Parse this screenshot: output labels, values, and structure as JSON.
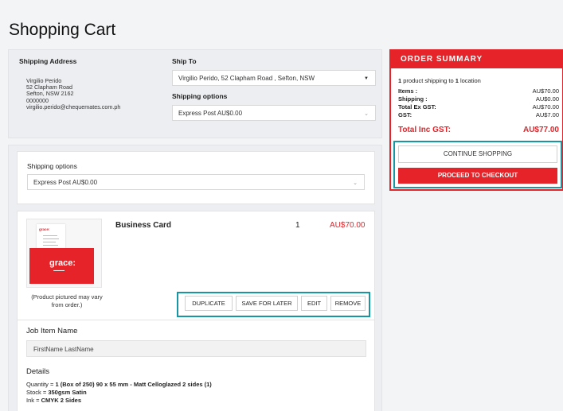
{
  "page": {
    "title": "Shopping Cart"
  },
  "shipping_address": {
    "title": "Shipping Address",
    "lines": [
      "Virgilio Perido",
      "52 Clapham Road",
      "Sefton, NSW 2162",
      "0000000",
      "virgilio.perido@chequemates.com.ph"
    ]
  },
  "ship_to": {
    "title": "Ship To",
    "selected": "Virgilio Perido, 52 Clapham Road , Sefton, NSW"
  },
  "shipping_options_top": {
    "title": "Shipping options",
    "selected": "Express Post AU$0.00"
  },
  "shipping_options_item": {
    "title": "Shipping options",
    "selected": "Express Post AU$0.00"
  },
  "item": {
    "name": "Business Card",
    "quantity": "1",
    "price": "AU$70.00",
    "thumb_logo": "grace:",
    "thumb_card_text": "grace:",
    "image_note": "(Product pictured may vary from order.)",
    "actions": {
      "duplicate": "DUPLICATE",
      "save_for_later": "SAVE FOR LATER",
      "edit": "EDIT",
      "remove": "REMOVE"
    },
    "job_item_title": "Job Item Name",
    "job_item_value": "FirstName LastName",
    "details_title": "Details",
    "details": {
      "quantity_label": "Quantity = ",
      "quantity_value": "1 (Box of 250) 90 x 55 mm - Matt Celloglazed 2 sides (1)",
      "stock_label": "Stock = ",
      "stock_value": "350gsm Satin",
      "ink_label": "Ink = ",
      "ink_value": "CMYK 2 Sides"
    }
  },
  "order_summary": {
    "title": "ORDER SUMMARY",
    "intro_count": "1",
    "intro_mid": " product shipping to ",
    "intro_locations": "1",
    "intro_end": " location",
    "rows": [
      {
        "label": "Items :",
        "value": "AU$70.00"
      },
      {
        "label": "Shipping :",
        "value": "AU$0.00"
      },
      {
        "label": "Total Ex GST:",
        "value": "AU$70.00"
      },
      {
        "label": "GST:",
        "value": "AU$7.00"
      }
    ],
    "total_label": "Total Inc GST:",
    "total_value": "AU$77.00",
    "continue_label": "CONTINUE SHOPPING",
    "checkout_label": "PROCEED TO CHECKOUT"
  },
  "colors": {
    "accent_red": "#e52329",
    "highlight_teal": "#1797a4"
  }
}
